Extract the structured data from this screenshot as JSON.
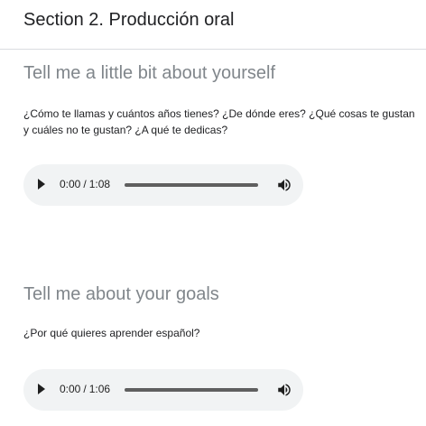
{
  "section": {
    "title": "Section 2. Producción oral"
  },
  "questions": [
    {
      "title": "Tell me a little bit about yourself",
      "description": "¿Cómo te llamas y cuántos años tienes? ¿De dónde eres? ¿Qué cosas te gustan y cuáles no te gustan? ¿A qué te dedicas?",
      "audio": {
        "current_time": "0:00",
        "separator": "/",
        "duration": "1:08",
        "progress": 0
      }
    },
    {
      "title": "Tell me about your goals",
      "description": "¿Por qué quieres aprender español?",
      "audio": {
        "current_time": "0:00",
        "separator": "/",
        "duration": "1:06",
        "progress": 0
      }
    }
  ],
  "icons": {
    "play": "play-icon",
    "volume": "volume-icon"
  },
  "colors": {
    "player_background": "#f1f3f4",
    "question_title": "#80868b",
    "section_title": "#202124"
  }
}
